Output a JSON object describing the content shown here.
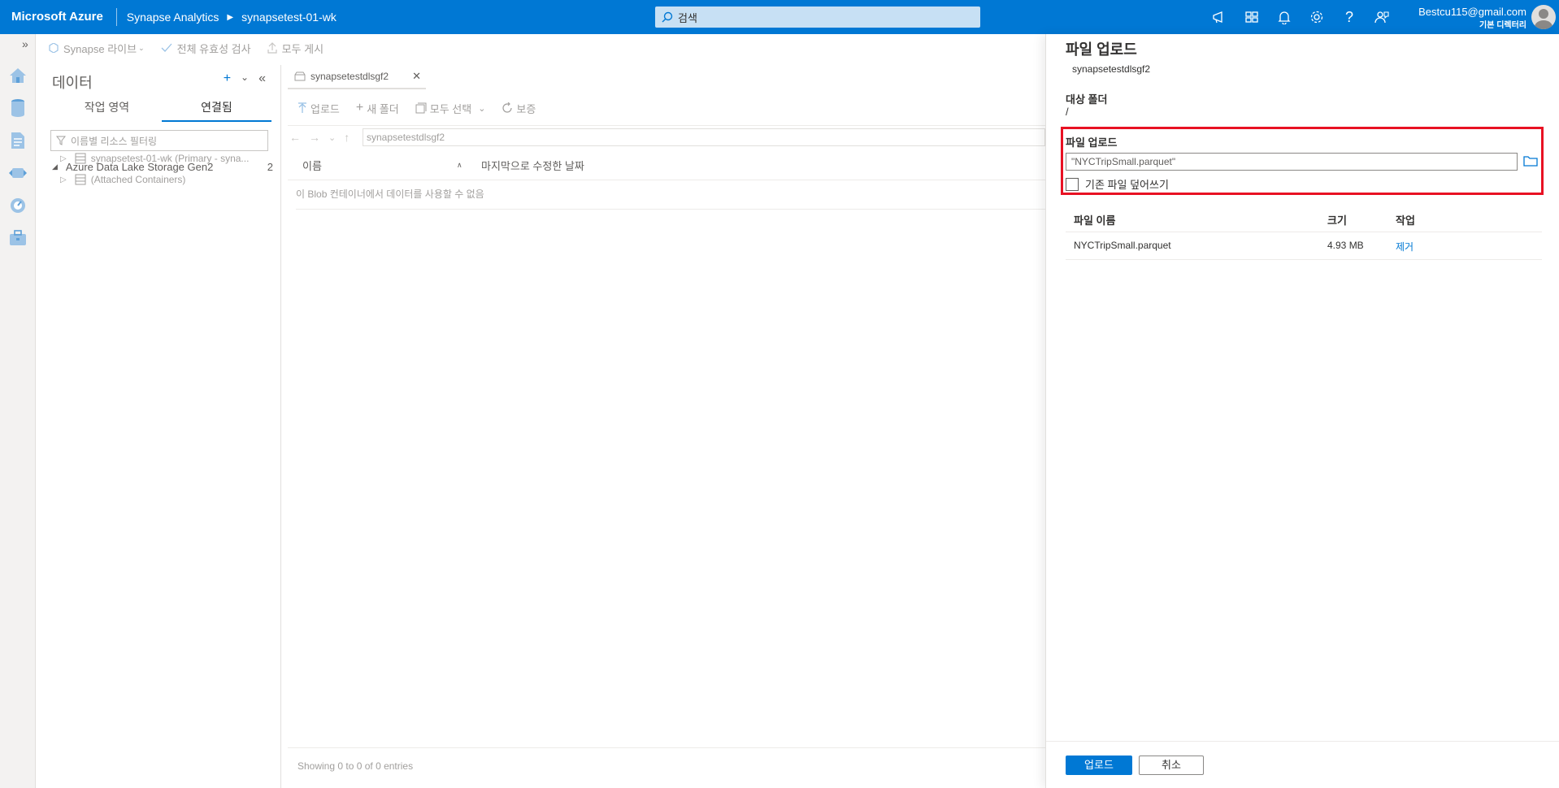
{
  "topbar": {
    "brand": "Microsoft Azure",
    "breadcrumb": [
      "Synapse Analytics",
      "synapsetest-01-wk"
    ],
    "search_placeholder": "검색",
    "account_email": "Bestcu115@gmail.com",
    "account_directory": "기본 디렉터리",
    "icons": [
      "announcement-icon",
      "portal-settings-icon",
      "notification-icon",
      "settings-icon",
      "help-icon",
      "feedback-icon"
    ]
  },
  "leftnav": {
    "icons": [
      "home-icon",
      "data-icon",
      "develop-icon",
      "integrate-icon",
      "monitor-icon",
      "manage-icon"
    ]
  },
  "commandbar": {
    "items": [
      "Synapse 라이브",
      "전체 유효성 검사",
      "모두 게시"
    ]
  },
  "datapanel": {
    "title": "데이터",
    "tabs": [
      "작업 영역",
      "연결됨"
    ],
    "active_tab": "연결됨",
    "filter_placeholder": "이름별 리소스 필터링",
    "tree": {
      "root_label": "Azure Data Lake Storage Gen2",
      "root_count": "2",
      "children": [
        "synapsetest-01-wk (Primary - syna...",
        "(Attached Containers)"
      ]
    }
  },
  "center": {
    "tab_label": "synapsetestdlsgf2",
    "toolbar": [
      "업로드",
      "새 폴더",
      "모두 선택",
      "보증"
    ],
    "path": "synapsetestdlsgf2",
    "columns": [
      "이름",
      "마지막으로 수정한 날짜"
    ],
    "empty_message": "이 Blob 컨테이너에서 데이터를 사용할 수 없음",
    "footer": "Showing 0 to 0 of 0 entries"
  },
  "flyout": {
    "title": "파일 업로드",
    "subtitle": "synapsetestdlsgf2",
    "target_folder_label": "대상 폴더",
    "target_folder_value": "/",
    "file_upload_label": "파일 업로드",
    "file_input_value": "\"NYCTripSmall.parquet\"",
    "overwrite_label": "기존 파일 덮어쓰기",
    "overwrite_checked": false,
    "table": {
      "headers": [
        "파일 이름",
        "크기",
        "작업"
      ],
      "rows": [
        {
          "name": "NYCTripSmall.parquet",
          "size": "4.93 MB",
          "action": "제거"
        }
      ]
    },
    "upload_button": "업로드",
    "cancel_button": "취소"
  },
  "colors": {
    "accent": "#0078d4",
    "highlight": "#e81123"
  }
}
